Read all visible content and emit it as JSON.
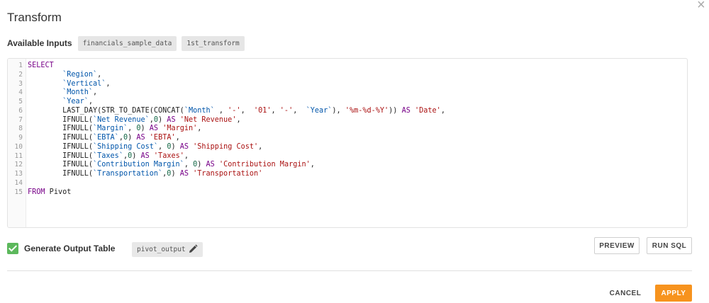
{
  "dialog": {
    "title": "Transform",
    "close_symbol": "×"
  },
  "inputs": {
    "label": "Available Inputs",
    "chips": [
      "financials_sample_data",
      "1st_transform"
    ]
  },
  "editor": {
    "lines": [
      [
        [
          "kw",
          "SELECT"
        ]
      ],
      [
        [
          "",
          "        "
        ],
        [
          "id",
          "`Region`"
        ],
        [
          "",
          ","
        ]
      ],
      [
        [
          "",
          "        "
        ],
        [
          "id",
          "`Vertical`"
        ],
        [
          "",
          ","
        ]
      ],
      [
        [
          "",
          "        "
        ],
        [
          "id",
          "`Month`"
        ],
        [
          "",
          ","
        ]
      ],
      [
        [
          "",
          "        "
        ],
        [
          "id",
          "`Year`"
        ],
        [
          "",
          ","
        ]
      ],
      [
        [
          "",
          "        LAST_DAY(STR_TO_DATE(CONCAT("
        ],
        [
          "id",
          "`Month`"
        ],
        [
          "",
          " , "
        ],
        [
          "str",
          "'-'"
        ],
        [
          "",
          ",  "
        ],
        [
          "str",
          "'01'"
        ],
        [
          "",
          ", "
        ],
        [
          "str",
          "'-'"
        ],
        [
          "",
          ",  "
        ],
        [
          "id",
          "`Year`"
        ],
        [
          "",
          "), "
        ],
        [
          "str",
          "'%m-%d-%Y'"
        ],
        [
          "",
          "))"
        ],
        [
          "kw",
          " AS "
        ],
        [
          "str",
          "'Date'"
        ],
        [
          "",
          ","
        ]
      ],
      [
        [
          "",
          "        IFNULL("
        ],
        [
          "id",
          "`Net Revenue`"
        ],
        [
          "",
          ","
        ],
        [
          "num",
          "0"
        ],
        [
          "",
          ")"
        ],
        [
          "kw",
          " AS "
        ],
        [
          "str",
          "'Net Revenue'"
        ],
        [
          "",
          ","
        ]
      ],
      [
        [
          "",
          "        IFNULL("
        ],
        [
          "id",
          "`Margin`"
        ],
        [
          "",
          ", "
        ],
        [
          "num",
          "0"
        ],
        [
          "",
          ")"
        ],
        [
          "kw",
          " AS "
        ],
        [
          "str",
          "'Margin'"
        ],
        [
          "",
          ","
        ]
      ],
      [
        [
          "",
          "        IFNULL("
        ],
        [
          "id",
          "`EBTA`"
        ],
        [
          "",
          ","
        ],
        [
          "num",
          "0"
        ],
        [
          "",
          ")"
        ],
        [
          "kw",
          " AS "
        ],
        [
          "str",
          "'EBTA'"
        ],
        [
          "",
          ","
        ]
      ],
      [
        [
          "",
          "        IFNULL("
        ],
        [
          "id",
          "`Shipping Cost`"
        ],
        [
          "",
          ", "
        ],
        [
          "num",
          "0"
        ],
        [
          "",
          ")"
        ],
        [
          "kw",
          " AS "
        ],
        [
          "str",
          "'Shipping Cost'"
        ],
        [
          "",
          ","
        ]
      ],
      [
        [
          "",
          "        IFNULL("
        ],
        [
          "id",
          "`Taxes`"
        ],
        [
          "",
          ","
        ],
        [
          "num",
          "0"
        ],
        [
          "",
          ")"
        ],
        [
          "kw",
          " AS "
        ],
        [
          "str",
          "'Taxes'"
        ],
        [
          "",
          ","
        ]
      ],
      [
        [
          "",
          "        IFNULL("
        ],
        [
          "id",
          "`Contribution Margin`"
        ],
        [
          "",
          ", "
        ],
        [
          "num",
          "0"
        ],
        [
          "",
          ")"
        ],
        [
          "kw",
          " AS "
        ],
        [
          "str",
          "'Contribution Margin'"
        ],
        [
          "",
          ","
        ]
      ],
      [
        [
          "",
          "        IFNULL("
        ],
        [
          "id",
          "`Transportation`"
        ],
        [
          "",
          ","
        ],
        [
          "num",
          "0"
        ],
        [
          "",
          ")"
        ],
        [
          "kw",
          " AS "
        ],
        [
          "str",
          "'Transportation'"
        ]
      ],
      [],
      [
        [
          "kw",
          "FROM"
        ],
        [
          "",
          " Pivot"
        ]
      ]
    ]
  },
  "generate": {
    "label": "Generate Output Table",
    "checked": true,
    "output_name": "pivot_output"
  },
  "buttons": {
    "preview": "PREVIEW",
    "run_sql": "RUN SQL",
    "cancel": "CANCEL",
    "apply": "APPLY"
  },
  "colors": {
    "accent": "#f7931e",
    "check": "#5cb85c"
  }
}
